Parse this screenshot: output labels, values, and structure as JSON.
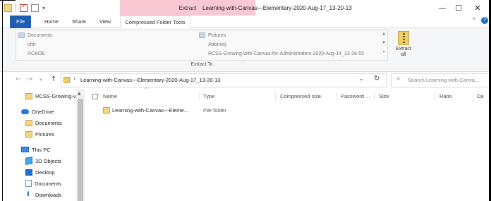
{
  "window": {
    "title": "Learning-with-Canvas---Elementary-2020-Aug-17_13-20-13",
    "context_label": "Extract",
    "minimize_glyph": "—",
    "maximize_glyph": "☐",
    "close_glyph": "✕"
  },
  "ribbon": {
    "tabs": [
      "File",
      "Home",
      "Share",
      "View",
      "Compressed Folder Tools"
    ],
    "gallery_left": [
      "Documents",
      "chtr",
      "RCBOE"
    ],
    "gallery_right": [
      "Pictures",
      "Attorney",
      "RCSS-Growing-with-Canvas-for-Administrators-2020-Aug-14_12-26-55"
    ],
    "group_label": "Extract To",
    "extract_all_label": "Extract all"
  },
  "address": {
    "path": "Learning-with-Canvas---Elementary-2020-Aug-17_13-20-13",
    "search_placeholder": "Search Learning-with-Canva..."
  },
  "navpane": {
    "items": [
      {
        "label": "RCSS-Growing-v",
        "icon": "folder-icon"
      },
      {
        "label": "OneDrive",
        "icon": "onedrive-icon"
      },
      {
        "label": "Documents",
        "icon": "folder-icon"
      },
      {
        "label": "Pictures",
        "icon": "folder-icon"
      },
      {
        "label": "This PC",
        "icon": "computer-icon"
      },
      {
        "label": "3D Objects",
        "icon": "3d-objects-icon"
      },
      {
        "label": "Desktop",
        "icon": "desktop-icon"
      },
      {
        "label": "Documents",
        "icon": "documents-icon"
      },
      {
        "label": "Downloads",
        "icon": "downloads-icon"
      }
    ]
  },
  "filelist": {
    "columns": [
      "Name",
      "Type",
      "Compressed size",
      "Password ...",
      "Size",
      "Ratio",
      "Da"
    ],
    "rows": [
      {
        "name": "Learning-with-Canvas---Eleme...",
        "type": "File folder"
      }
    ]
  },
  "colors": {
    "file_tab": "#1f5fb1",
    "context_band": "#f8c8d3",
    "folder_yellow": "#f3d77c"
  }
}
